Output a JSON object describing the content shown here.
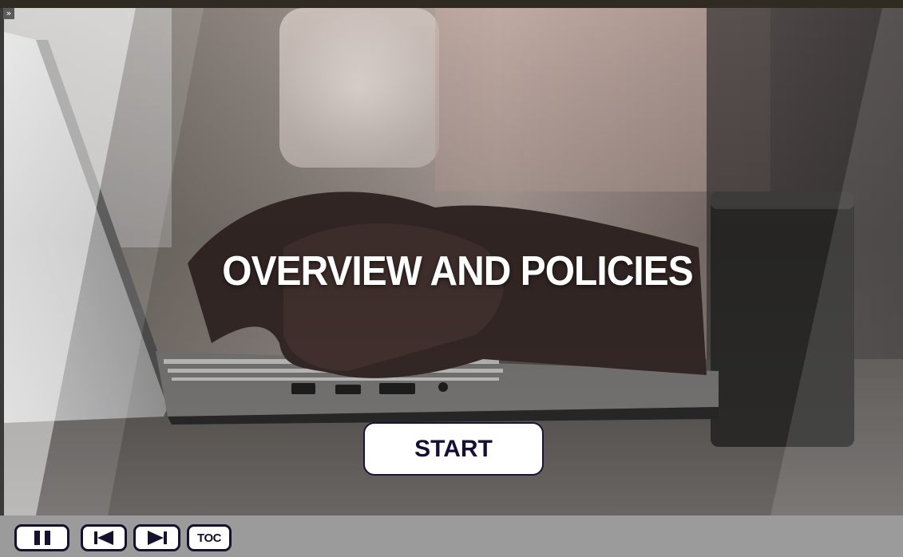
{
  "slide": {
    "title": "OVERVIEW AND POLICIES",
    "start_label": "START",
    "background_image": "hands-typing-on-laptop-photo"
  },
  "menu": {
    "toggle_glyph": "»"
  },
  "toolbar": {
    "pause_icon": "pause-icon",
    "prev_icon": "skip-back-icon",
    "next_icon": "skip-forward-icon",
    "toc_label": "TOC"
  },
  "colors": {
    "button_border": "#17112e",
    "button_text": "#170e33",
    "toolbar_bg": "#9b9b9b",
    "title_text": "#ffffff"
  }
}
